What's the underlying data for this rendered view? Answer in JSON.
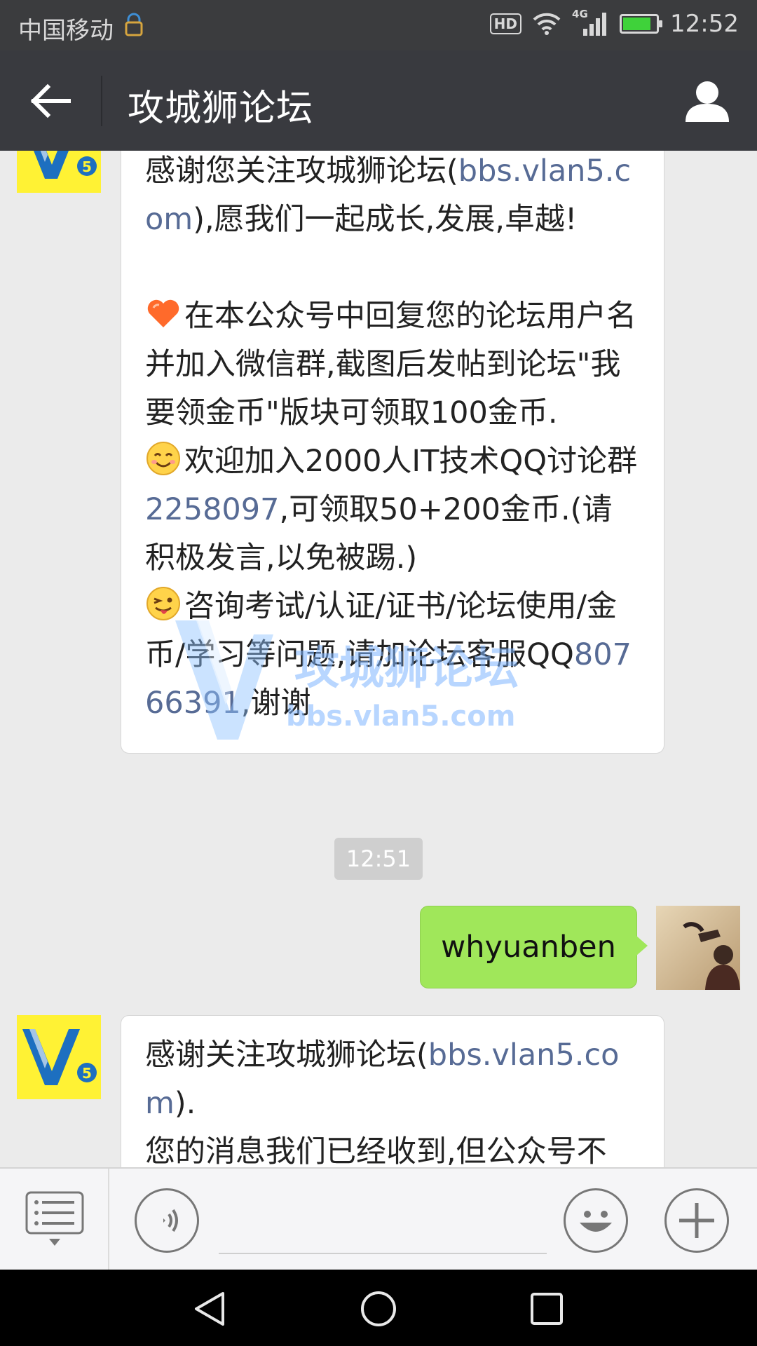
{
  "status_bar": {
    "carrier": "中国移动",
    "hd": "HD",
    "network": "4G",
    "time": "12:52",
    "battery_level": 0.85
  },
  "titlebar": {
    "title": "攻城狮论坛",
    "back_icon": "arrow-left-icon",
    "profile_icon": "person-icon"
  },
  "messages": {
    "msg1": {
      "line1_pre": "感谢您关注攻城狮论坛(",
      "line1_link": "bbs.vlan5.com",
      "line1_post": "),愿我们一起成长,发展,卓越!",
      "item1": "在本公众号中回复您的论坛用户名并加入微信群,截图后发帖到论坛\"我要领金币\"版块可领取100金币.",
      "item2_pre": "欢迎加入2000人IT技术QQ讨论群",
      "item2_link": "2258097",
      "item2_post": ",可领取50+200金币.(请积极发言,以免被踢.)",
      "item3_pre": "咨询考试/认证/证书/论坛使用/金币/学习等问题,请加论坛客服QQ",
      "item3_link": "80766391",
      "item3_post": ",谢谢"
    },
    "timestamp": "12:51",
    "outgoing": "whyuanben",
    "msg2": {
      "line1_pre": "感谢关注攻城狮论坛(",
      "line1_link": "bbs.vlan5.com",
      "line1_post": ").",
      "line2": "您的消息我们已经收到,但公众号不"
    },
    "watermark": {
      "brand": "攻城狮论坛",
      "url": "bbs.vlan5.com"
    }
  },
  "colors": {
    "titlebar_bg": "#393a3f",
    "link": "#576b95",
    "outgoing_bubble": "#a0e75a",
    "v5_avatar_bg": "#fff234"
  }
}
